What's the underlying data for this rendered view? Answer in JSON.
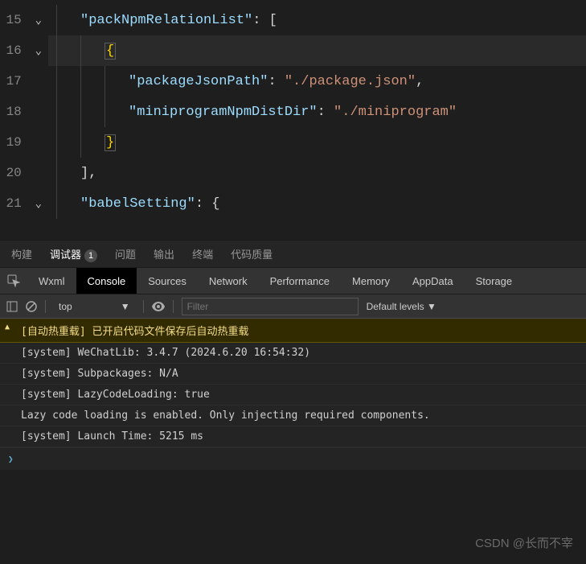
{
  "editor": {
    "lines": [
      {
        "num": "15",
        "chev": true
      },
      {
        "num": "16",
        "chev": true,
        "current": true
      },
      {
        "num": "17",
        "chev": false
      },
      {
        "num": "18",
        "chev": false
      },
      {
        "num": "19",
        "chev": false
      },
      {
        "num": "20",
        "chev": false
      },
      {
        "num": "21",
        "chev": true
      }
    ],
    "code": {
      "l15_key": "\"packNpmRelationList\"",
      "l15_after": ": [",
      "l16_brace": "{",
      "l17_key": "\"packageJsonPath\"",
      "l17_sep": ": ",
      "l17_val": "\"./package.json\"",
      "l17_comma": ",",
      "l18_key": "\"miniprogramNpmDistDir\"",
      "l18_sep": ": ",
      "l18_val": "\"./miniprogram\"",
      "l19_brace": "}",
      "l20": "],",
      "l21_key": "\"babelSetting\"",
      "l21_after": ": {"
    }
  },
  "panel": {
    "tabs": [
      "构建",
      "调试器",
      "问题",
      "输出",
      "终端",
      "代码质量"
    ],
    "active": "调试器",
    "badge": "1"
  },
  "devtools": {
    "tabs": [
      "Wxml",
      "Console",
      "Sources",
      "Network",
      "Performance",
      "Memory",
      "AppData",
      "Storage"
    ],
    "active": "Console"
  },
  "consoleBar": {
    "context": "top",
    "filterPlaceholder": "Filter",
    "levels": "Default levels ▼"
  },
  "console": {
    "lines": [
      {
        "type": "warn",
        "text": "[自动热重载] 已开启代码文件保存后自动热重载"
      },
      {
        "type": "log",
        "text": "[system] WeChatLib: 3.4.7 (2024.6.20 16:54:32)"
      },
      {
        "type": "log",
        "text": "[system] Subpackages: N/A"
      },
      {
        "type": "log",
        "text": "[system] LazyCodeLoading: true"
      },
      {
        "type": "log",
        "text": "Lazy code loading is enabled. Only injecting required components."
      },
      {
        "type": "log",
        "text": "[system] Launch Time: 5215 ms"
      }
    ]
  },
  "watermark": "CSDN @长而不宰"
}
